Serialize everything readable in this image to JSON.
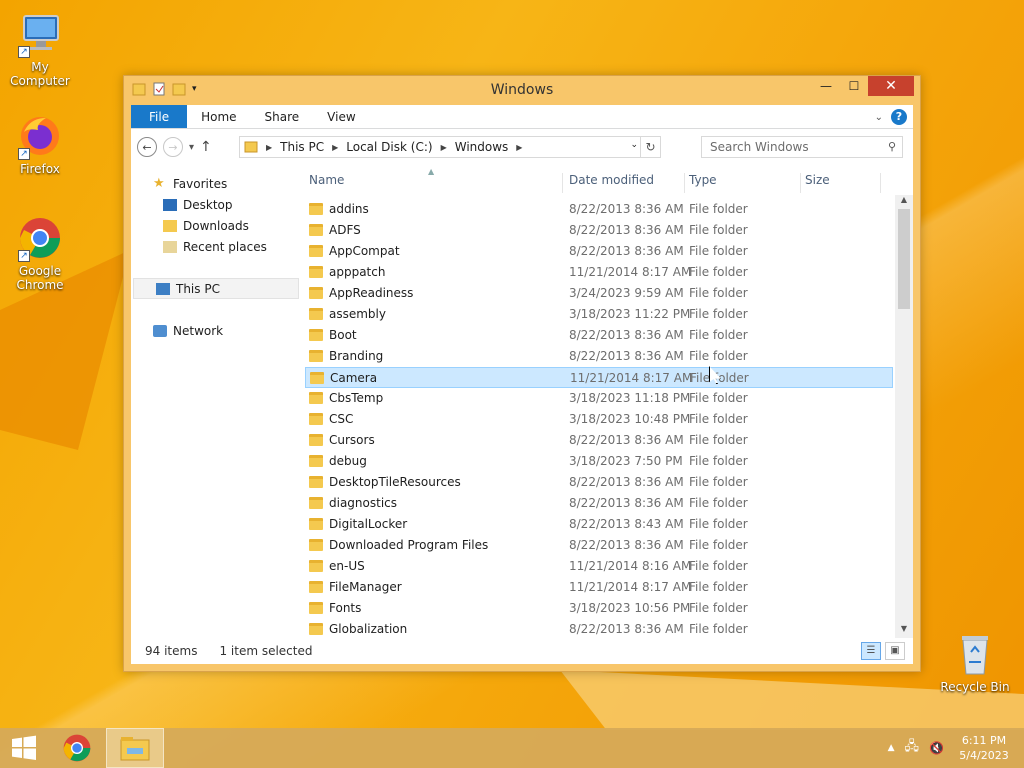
{
  "desktop": {
    "icons": [
      {
        "label": "My Computer",
        "icon": "computer-icon"
      },
      {
        "label": "Firefox",
        "icon": "firefox-icon"
      },
      {
        "label": "Google Chrome",
        "icon": "chrome-icon"
      },
      {
        "label": "Recycle Bin",
        "icon": "recycle-bin-icon"
      }
    ]
  },
  "window": {
    "title": "Windows",
    "ribbon_tabs": [
      "File",
      "Home",
      "Share",
      "View"
    ],
    "breadcrumb": [
      "This PC",
      "Local Disk (C:)",
      "Windows"
    ],
    "search_placeholder": "Search Windows",
    "nav": {
      "favorites": "Favorites",
      "desktop": "Desktop",
      "downloads": "Downloads",
      "recent": "Recent places",
      "thispc": "This PC",
      "network": "Network"
    },
    "columns": [
      "Name",
      "Date modified",
      "Type",
      "Size"
    ],
    "files": [
      {
        "name": "addins",
        "date": "8/22/2013 8:36 AM",
        "type": "File folder"
      },
      {
        "name": "ADFS",
        "date": "8/22/2013 8:36 AM",
        "type": "File folder"
      },
      {
        "name": "AppCompat",
        "date": "8/22/2013 8:36 AM",
        "type": "File folder"
      },
      {
        "name": "apppatch",
        "date": "11/21/2014 8:17 AM",
        "type": "File folder"
      },
      {
        "name": "AppReadiness",
        "date": "3/24/2023 9:59 AM",
        "type": "File folder"
      },
      {
        "name": "assembly",
        "date": "3/18/2023 11:22 PM",
        "type": "File folder"
      },
      {
        "name": "Boot",
        "date": "8/22/2013 8:36 AM",
        "type": "File folder"
      },
      {
        "name": "Branding",
        "date": "8/22/2013 8:36 AM",
        "type": "File folder"
      },
      {
        "name": "Camera",
        "date": "11/21/2014 8:17 AM",
        "type": "File folder",
        "selected": true
      },
      {
        "name": "CbsTemp",
        "date": "3/18/2023 11:18 PM",
        "type": "File folder"
      },
      {
        "name": "CSC",
        "date": "3/18/2023 10:48 PM",
        "type": "File folder"
      },
      {
        "name": "Cursors",
        "date": "8/22/2013 8:36 AM",
        "type": "File folder"
      },
      {
        "name": "debug",
        "date": "3/18/2023 7:50 PM",
        "type": "File folder"
      },
      {
        "name": "DesktopTileResources",
        "date": "8/22/2013 8:36 AM",
        "type": "File folder"
      },
      {
        "name": "diagnostics",
        "date": "8/22/2013 8:36 AM",
        "type": "File folder"
      },
      {
        "name": "DigitalLocker",
        "date": "8/22/2013 8:43 AM",
        "type": "File folder"
      },
      {
        "name": "Downloaded Program Files",
        "date": "8/22/2013 8:36 AM",
        "type": "File folder"
      },
      {
        "name": "en-US",
        "date": "11/21/2014 8:16 AM",
        "type": "File folder"
      },
      {
        "name": "FileManager",
        "date": "11/21/2014 8:17 AM",
        "type": "File folder"
      },
      {
        "name": "Fonts",
        "date": "3/18/2023 10:56 PM",
        "type": "File folder"
      },
      {
        "name": "Globalization",
        "date": "8/22/2013 8:36 AM",
        "type": "File folder"
      }
    ],
    "status_items": "94 items",
    "status_selected": "1 item selected"
  },
  "taskbar": {
    "time": "6:11 PM",
    "date": "5/4/2023"
  }
}
